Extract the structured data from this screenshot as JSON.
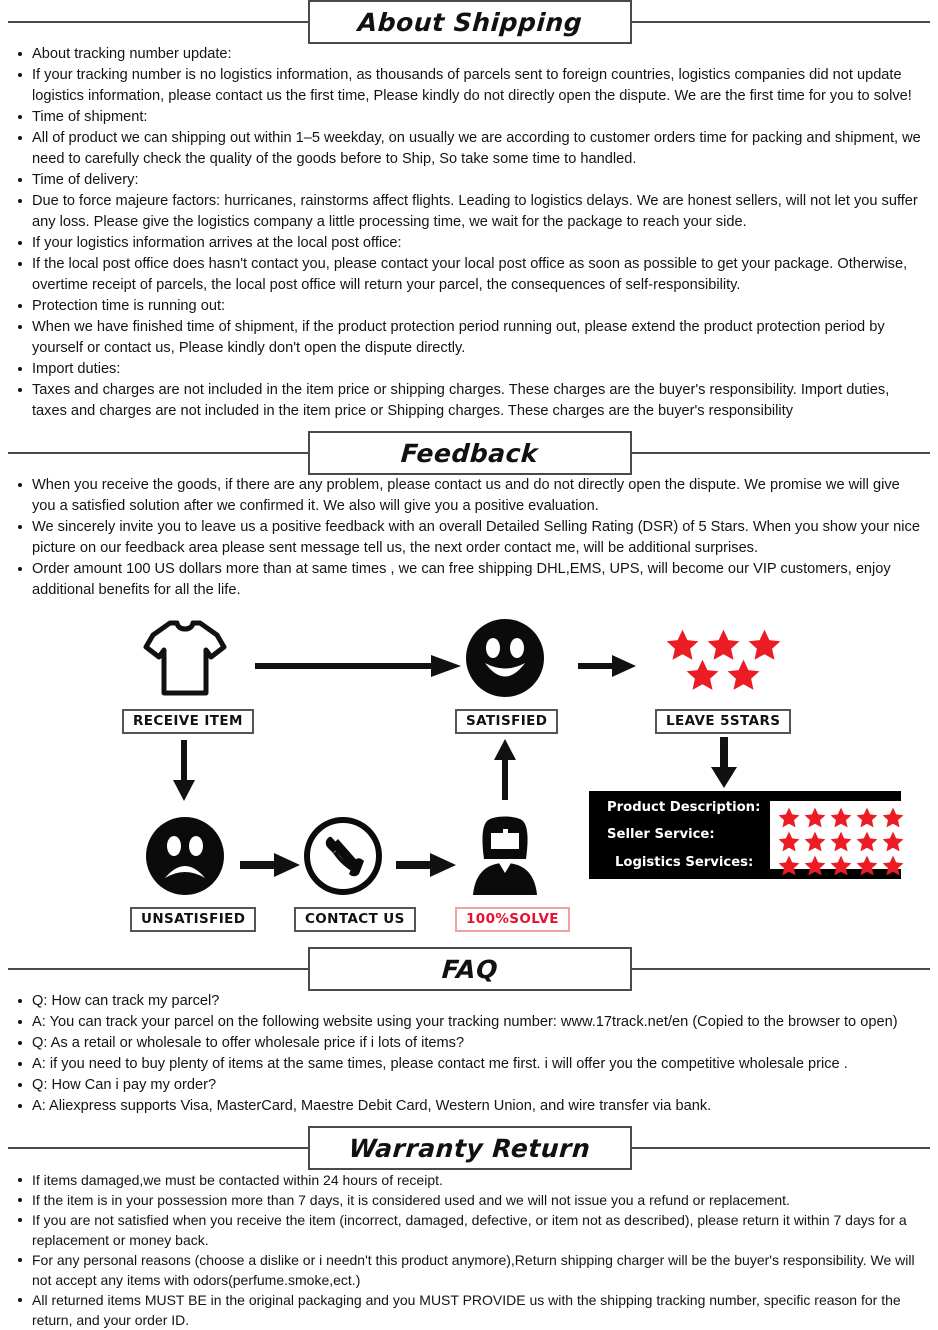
{
  "sections": {
    "shipping": {
      "title": "About Shipping",
      "items": [
        "About tracking number update:",
        "If your tracking number is no logistics information, as thousands of parcels sent to foreign countries, logistics companies did not update logistics information, please contact us the first time, Please kindly do not directly open the dispute. We are the first time for you to solve!",
        "Time of shipment:",
        "All of product we can shipping out within 1–5 weekday, on usually we are according to customer orders time for packing and shipment, we need to carefully check the quality of the goods before to Ship, So take some time to handled.",
        "Time of delivery:",
        "Due to force majeure factors: hurricanes, rainstorms affect flights. Leading to logistics delays. We are honest sellers, will not let you suffer any loss. Please give the logistics company a little processing time, we wait for the package to reach your side.",
        "If your logistics information arrives at the local post office:",
        "If the local post office does hasn't contact you, please contact your local post office as soon as possible to get your package. Otherwise, overtime receipt of parcels, the local post office will return your parcel, the consequences of self-responsibility.",
        "Protection time is running out:",
        "When we have finished time of shipment, if the product protection period running out, please extend the product protection period by yourself or contact us, Please kindly don't open the dispute directly.",
        "Import duties:",
        "Taxes and charges are not included in the item price or shipping charges. These charges are the buyer's responsibility. Import duties, taxes and charges are not included in the item price or Shipping charges. These charges are the buyer's responsibility"
      ]
    },
    "feedback": {
      "title": "Feedback",
      "items": [
        "When you receive the goods, if there are any problem, please contact us and do not directly open the dispute. We promise we will give you a satisfied solution after we confirmed it. We also will give you a positive evaluation.",
        "We sincerely invite you to leave us a positive feedback with an overall Detailed Selling Rating (DSR) of 5 Stars. When you show your nice picture on our feedback area please sent message tell us, the next order contact me, will be additional surprises.",
        "Order amount 100 US dollars more than at same times , we can free shipping DHL,EMS, UPS, will become our VIP customers, enjoy additional benefits for all the life."
      ]
    },
    "faq": {
      "title": "FAQ",
      "items": [
        "Q: How can track my parcel?",
        "A: You can track your parcel on the following website using your tracking number: www.17track.net/en (Copied to the browser to open)",
        "Q: As a retail or wholesale to offer wholesale price if i lots of items?",
        "A: if you need to buy plenty of items at the same times, please contact me first. i will offer you the competitive wholesale price .",
        "Q: How Can i pay my order?",
        "A: Aliexpress supports Visa, MasterCard, Maestre Debit Card, Western Union, and wire transfer via bank."
      ]
    },
    "warranty": {
      "title": "Warranty Return",
      "items": [
        "If items damaged,we must be contacted within 24 hours of receipt.",
        "If the item is in your possession more than 7 days, it is considered used and we will not issue you a refund or  replacement.",
        "If you are not satisfied when you receive the item (incorrect, damaged, defective, or item not as described), please return it within 7 days for a replacement or money back.",
        "For any personal reasons (choose a dislike or i needn't this product anymore),Return shipping charger will be the buyer's responsibility. We will not accept any items with odors(perfume.smoke,ect.)",
        "All returned items MUST BE in the original packaging and you MUST PROVIDE us with the shipping tracking number, specific reason for the return, and your order ID."
      ]
    }
  },
  "diagram": {
    "nodes": {
      "receive_item": "RECEIVE ITEM",
      "satisfied": "SATISFIED",
      "leave_5stars": "LEAVE 5STARS",
      "unsatisfied": "UNSATISFIED",
      "contact_us": "CONTACT US",
      "solve": "100%SOLVE"
    },
    "rating_panel": {
      "rows": [
        "Product Description:",
        "Seller Service:",
        "Logistics Services:"
      ],
      "stars_per_row": 5
    },
    "star_count": 5,
    "colors": {
      "star_red": "#ec1c24",
      "panel_background": "#000000",
      "solve_text": "#e8112d"
    }
  }
}
